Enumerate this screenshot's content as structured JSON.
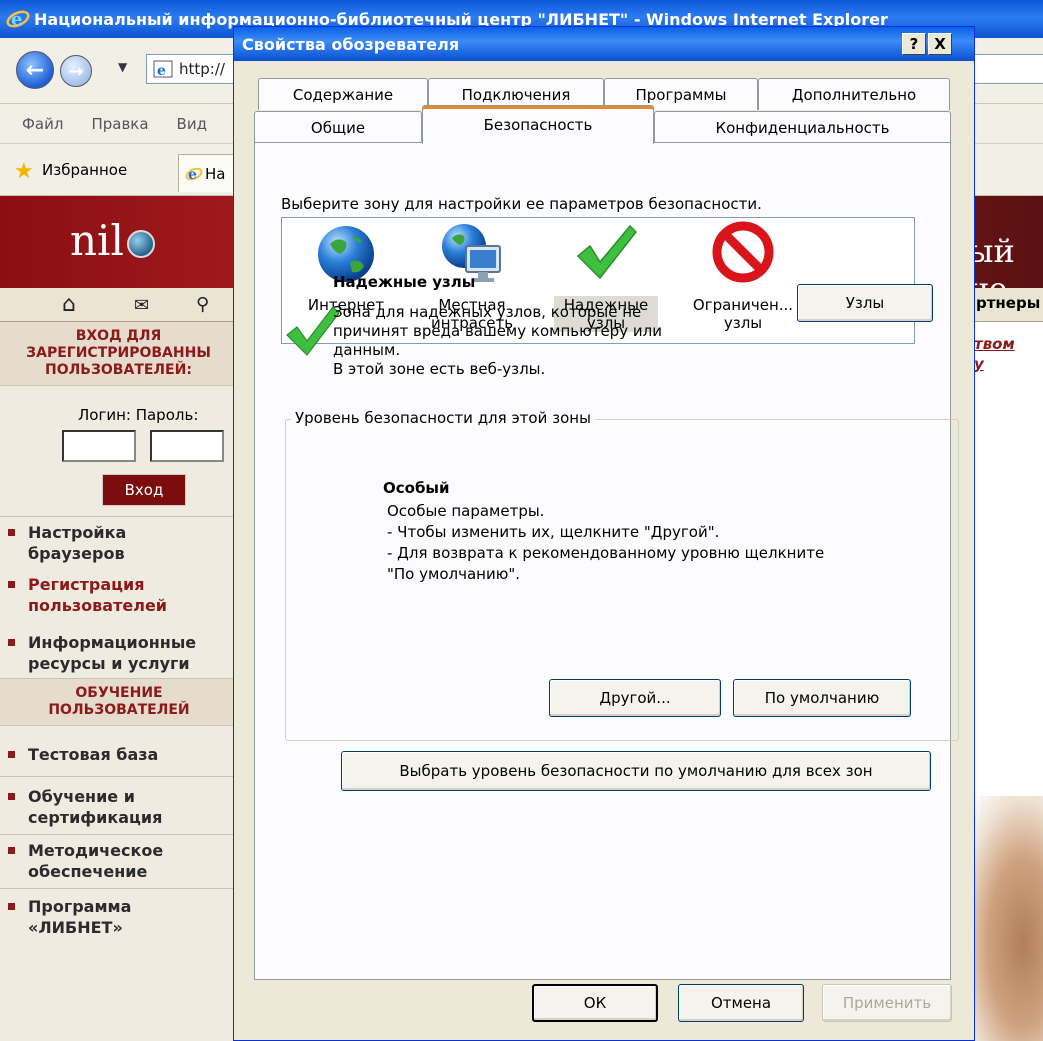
{
  "browser": {
    "title": "Национальный информационно-библиотечный центр \"ЛИБНЕТ\" - Windows Internet Explorer",
    "address": "http://",
    "menu": [
      "Файл",
      "Правка",
      "Вид"
    ],
    "favorites_label": "Избранное",
    "tab_label": "На"
  },
  "site": {
    "logo_text": "nil",
    "header_right": "ый це",
    "tools_right": "ртнеры",
    "right_links": [
      "твом",
      "у"
    ],
    "login_head": "ВХОД ДЛЯ ЗАРЕГИСТРИРОВАННЫХ ПОЛЬЗОВАТЕЛЕЙ:",
    "login_head_lines": [
      "ВХОД ДЛЯ",
      "ЗАРЕГИСТРИРОВАННЫ",
      "ПОЛЬЗОВАТЕЛЕЙ:"
    ],
    "login_label": "Логин: Пароль:",
    "login_button": "Вход",
    "links_top": [
      {
        "label": "Настройка браузеров",
        "lines": [
          "Настройка",
          "браузеров"
        ]
      },
      {
        "label": "Регистрация пользователей",
        "lines": [
          "Регистрация",
          "пользователей"
        ]
      },
      {
        "label": "Информационные ресурсы и услуги",
        "lines": [
          "Информационные",
          "ресурсы и услуги"
        ]
      }
    ],
    "training_head_lines": [
      "ОБУЧЕНИЕ",
      "ПОЛЬЗОВАТЕЛЕЙ"
    ],
    "links_bottom": [
      {
        "lines": [
          "Тестовая база"
        ]
      },
      {
        "lines": [
          "Обучение и",
          "сертификация"
        ]
      },
      {
        "lines": [
          "Методическое",
          "обеспечение"
        ]
      },
      {
        "lines": [
          "Программа",
          "«ЛИБНЕТ»"
        ]
      }
    ]
  },
  "dialog": {
    "title": "Свойства обозревателя",
    "help_button": "?",
    "close_button": "X",
    "tabs_back": [
      "Содержание",
      "Подключения",
      "Программы",
      "Дополнительно"
    ],
    "tabs_front": [
      "Общие",
      "Безопасность",
      "Конфиденциальность"
    ],
    "active_tab": "Безопасность",
    "zone_prompt": "Выберите зону для настройки ее параметров безопасности.",
    "zones": [
      {
        "lines": [
          "Интернет"
        ],
        "icon": "globe-icon"
      },
      {
        "lines": [
          "Местная",
          "интрасеть"
        ],
        "icon": "intranet-icon"
      },
      {
        "lines": [
          "Надежные",
          "узлы"
        ],
        "icon": "checkmark-icon",
        "selected": true
      },
      {
        "lines": [
          "Ограничен...",
          "узлы"
        ],
        "icon": "restricted-icon"
      }
    ],
    "zone_name": "Надежные узлы",
    "zone_desc_lines": [
      "Зона для надежных узлов, которые не",
      "причинят вреда вашему компьютеру или",
      "данным.",
      "В этой зоне есть веб-узлы."
    ],
    "sites_button": "Узлы",
    "level_legend": "Уровень безопасности для этой зоны",
    "level_name": "Особый",
    "level_desc_lines": [
      "Особые параметры.",
      "- Чтобы изменить их, щелкните \"Другой\".",
      "- Для возврата к рекомендованному уровню щелкните",
      "\"По умолчанию\"."
    ],
    "custom_button": "Другой...",
    "default_button": "По умолчанию",
    "reset_all_button": "Выбрать уровень безопасности по умолчанию для всех зон",
    "ok_button": "ОК",
    "cancel_button": "Отмена",
    "apply_button": "Применить"
  }
}
